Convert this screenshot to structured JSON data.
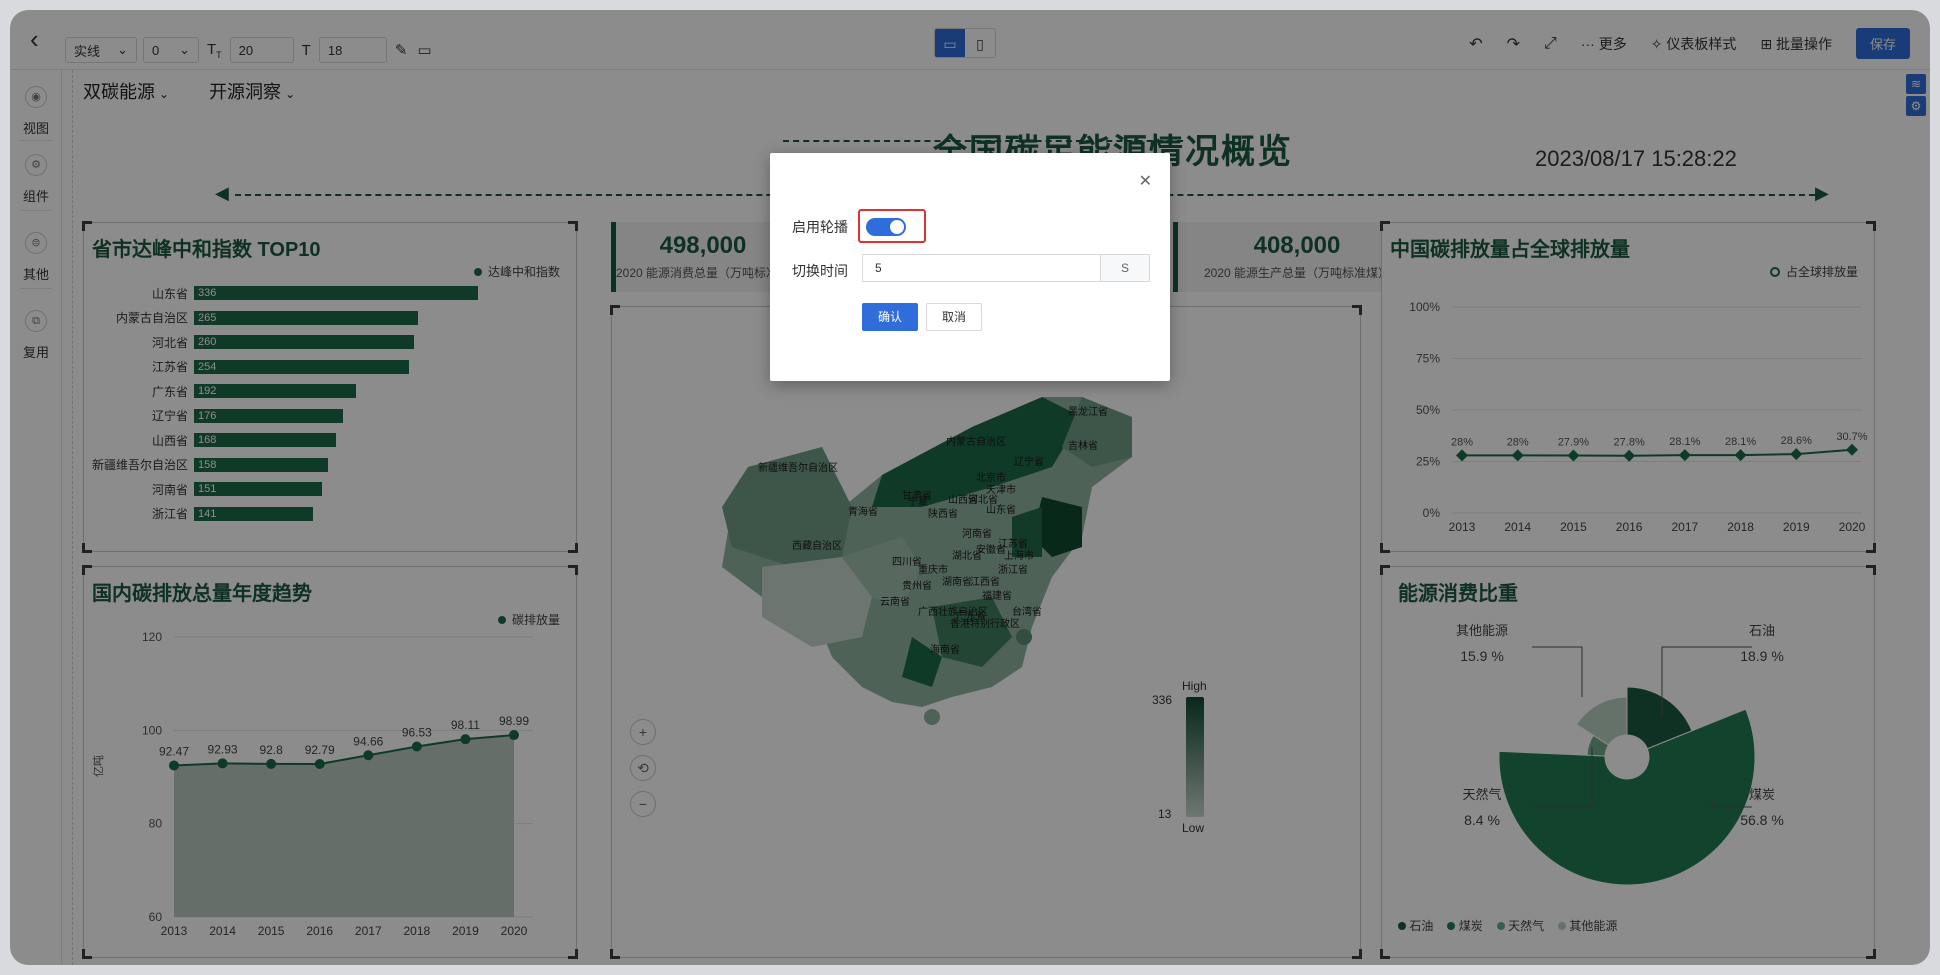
{
  "toolbar": {
    "line_style": "实线",
    "line_width": "0",
    "font_size_1": "20",
    "font_size_2": "18",
    "actions": {
      "more": "更多",
      "dashboard_style": "仪表板样式",
      "batch": "批量操作",
      "save": "保存"
    }
  },
  "left_rail": {
    "items": [
      {
        "label": "视图"
      },
      {
        "label": "组件"
      },
      {
        "label": "其他"
      },
      {
        "label": "复用"
      }
    ]
  },
  "filters": [
    "双碳能源",
    "开源洞察"
  ],
  "dashboard": {
    "title": "全国碳足能源情况概览",
    "datetime": "2023/08/17 15:28:22"
  },
  "panel_top10": {
    "title": "省市达峰中和指数 TOP10",
    "legend": "达峰中和指数",
    "rows": [
      {
        "label": "山东省",
        "value": "336",
        "v": 336
      },
      {
        "label": "内蒙古自治区",
        "value": "265",
        "v": 265
      },
      {
        "label": "河北省",
        "value": "260",
        "v": 260
      },
      {
        "label": "江苏省",
        "value": "254",
        "v": 254
      },
      {
        "label": "广东省",
        "value": "192",
        "v": 192
      },
      {
        "label": "辽宁省",
        "value": "176",
        "v": 176
      },
      {
        "label": "山西省",
        "value": "168",
        "v": 168
      },
      {
        "label": "新疆维吾尔自治区",
        "value": "158",
        "v": 158
      },
      {
        "label": "河南省",
        "value": "151",
        "v": 151
      },
      {
        "label": "浙江省",
        "value": "141",
        "v": 141
      }
    ]
  },
  "panel_trend": {
    "title": "国内碳排放总量年度趋势",
    "legend": "碳排放量",
    "ylabel": "亿吨"
  },
  "kpis": [
    {
      "value": "498,000",
      "label": "2020 能源消费总量（万吨标准煤）"
    },
    {
      "value": "408,000",
      "label": "2020 能源生产总量（万吨标准煤）"
    }
  ],
  "map": {
    "regions": [
      "新疆维吾尔自治区",
      "西藏自治区",
      "青海省",
      "甘肃省",
      "内蒙古自治区",
      "黑龙江省",
      "吉林省",
      "辽宁省",
      "北京市",
      "天津市",
      "河北省",
      "山东省",
      "山西省",
      "宁夏",
      "陕西省",
      "河南省",
      "江苏省",
      "上海市",
      "安徽省",
      "湖北省",
      "四川省",
      "重庆市",
      "浙江省",
      "贵州省",
      "湖南省",
      "江西省",
      "福建省",
      "云南省",
      "广西壮族自治区",
      "广东省",
      "台湾省",
      "香港特别行政区",
      "海南省"
    ],
    "visual_map": {
      "high": "High",
      "low": "Low",
      "max": "336",
      "min": "13"
    }
  },
  "panel_share": {
    "title": "中国碳排放量占全球排放量",
    "legend": "占全球排放量"
  },
  "panel_energy": {
    "title": "能源消费比重",
    "legend": [
      "石油",
      "煤炭",
      "天然气",
      "其他能源"
    ],
    "labels": [
      {
        "name": "其他能源",
        "pct": "15.9 %"
      },
      {
        "name": "石油",
        "pct": "18.9 %"
      },
      {
        "name": "天然气",
        "pct": "8.4 %"
      },
      {
        "name": "煤炭",
        "pct": "56.8 %"
      }
    ]
  },
  "modal": {
    "carousel_label": "启用轮播",
    "interval_label": "切换时间",
    "interval_value": "5",
    "interval_unit": "S",
    "confirm": "确认",
    "cancel": "取消"
  },
  "chart_data": [
    {
      "type": "bar",
      "title": "省市达峰中和指数 TOP10",
      "categories": [
        "山东省",
        "内蒙古自治区",
        "河北省",
        "江苏省",
        "广东省",
        "辽宁省",
        "山西省",
        "新疆维吾尔自治区",
        "河南省",
        "浙江省"
      ],
      "series": [
        {
          "name": "达峰中和指数",
          "values": [
            336,
            265,
            260,
            254,
            192,
            176,
            168,
            158,
            151,
            141
          ]
        }
      ]
    },
    {
      "type": "area",
      "title": "国内碳排放总量年度趋势",
      "x": [
        "2013",
        "2014",
        "2015",
        "2016",
        "2017",
        "2018",
        "2019",
        "2020"
      ],
      "series": [
        {
          "name": "碳排放量",
          "values": [
            92.47,
            92.93,
            92.8,
            92.79,
            94.66,
            96.53,
            98.11,
            98.99
          ]
        }
      ],
      "ylabel": "亿吨",
      "ylim": [
        60,
        120
      ],
      "yticks": [
        "60",
        "80",
        "100",
        "120"
      ]
    },
    {
      "type": "line",
      "title": "中国碳排放量占全球排放量",
      "x": [
        "2013",
        "2014",
        "2015",
        "2016",
        "2017",
        "2018",
        "2019",
        "2020"
      ],
      "series": [
        {
          "name": "占全球排放量",
          "values": [
            28,
            28,
            27.9,
            27.8,
            28.1,
            28.1,
            28.6,
            30.7
          ],
          "labels": [
            "28%",
            "28%",
            "27.9%",
            "27.8%",
            "28.1%",
            "28.1%",
            "28.6%",
            "30.7%"
          ]
        }
      ],
      "ylim": [
        0,
        100
      ],
      "yticks": [
        "0%",
        "25%",
        "50%",
        "75%",
        "100%"
      ]
    },
    {
      "type": "pie",
      "title": "能源消费比重",
      "categories": [
        "石油",
        "煤炭",
        "天然气",
        "其他能源"
      ],
      "values": [
        18.9,
        56.8,
        8.4,
        15.9
      ]
    }
  ]
}
